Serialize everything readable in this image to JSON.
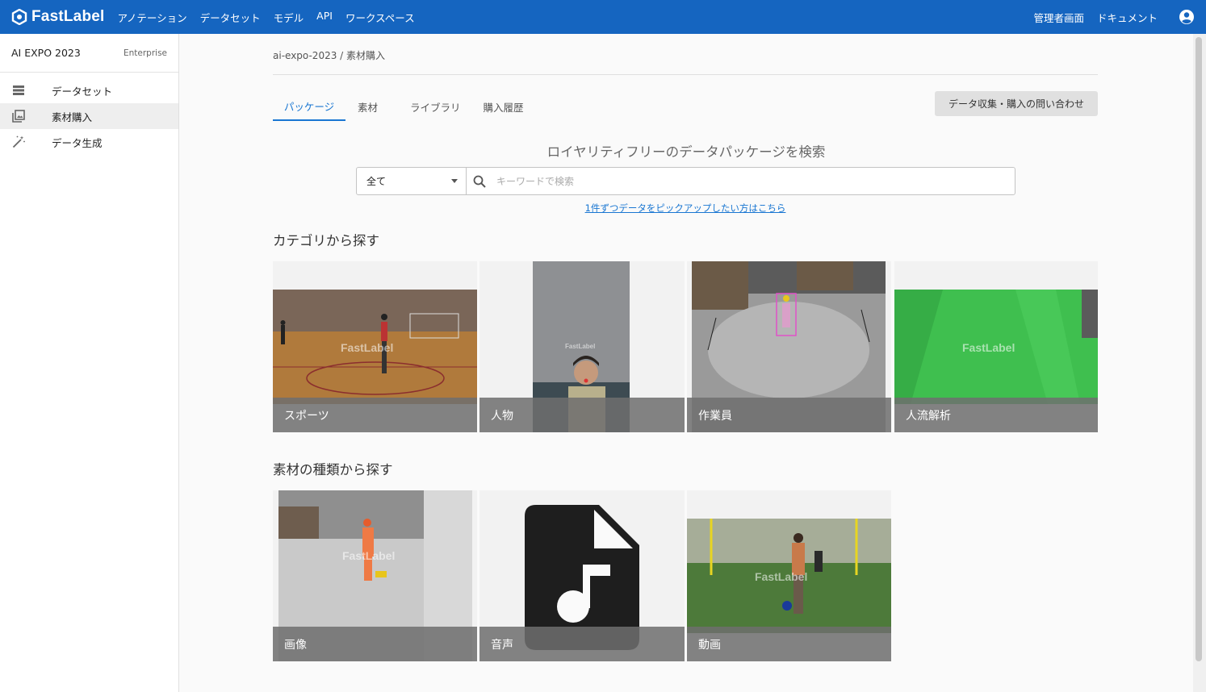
{
  "header": {
    "brand": "FastLabel",
    "nav": [
      "アノテーション",
      "データセット",
      "モデル",
      "API",
      "ワークスペース"
    ],
    "right_links": [
      "管理者画面",
      "ドキュメント"
    ],
    "account_icon": "account-circle-icon"
  },
  "sidebar": {
    "workspace_name": "AI EXPO 2023",
    "plan": "Enterprise",
    "items": [
      {
        "label": "データセット",
        "icon": "list-icon"
      },
      {
        "label": "素材購入",
        "icon": "image-library-icon",
        "active": true
      },
      {
        "label": "データ生成",
        "icon": "magic-wand-icon"
      }
    ]
  },
  "main": {
    "breadcrumb": "ai-expo-2023 / 素材購入",
    "tabs": [
      {
        "label": "パッケージ",
        "active": true
      },
      {
        "label": "素材"
      },
      {
        "label": "ライブラリ"
      },
      {
        "label": "購入履歴"
      }
    ],
    "contact_button": "データ収集・購入の問い合わせ",
    "search": {
      "title": "ロイヤリティフリーのデータパッケージを検索",
      "select_value": "全て",
      "placeholder": "キーワードで検索"
    },
    "pick_link": "1件ずつデータをピックアップしたい方はこちら",
    "category_section": {
      "title": "カテゴリから探す",
      "cards": [
        "スポーツ",
        "人物",
        "作業員",
        "人流解析"
      ]
    },
    "type_section": {
      "title": "素材の種類から探す",
      "cards": [
        "画像",
        "音声",
        "動画"
      ]
    },
    "watermark": "FastLabel"
  },
  "colors": {
    "primary": "#1565c0",
    "accent": "#1976d2",
    "green_screen": "#3fbf4f"
  }
}
